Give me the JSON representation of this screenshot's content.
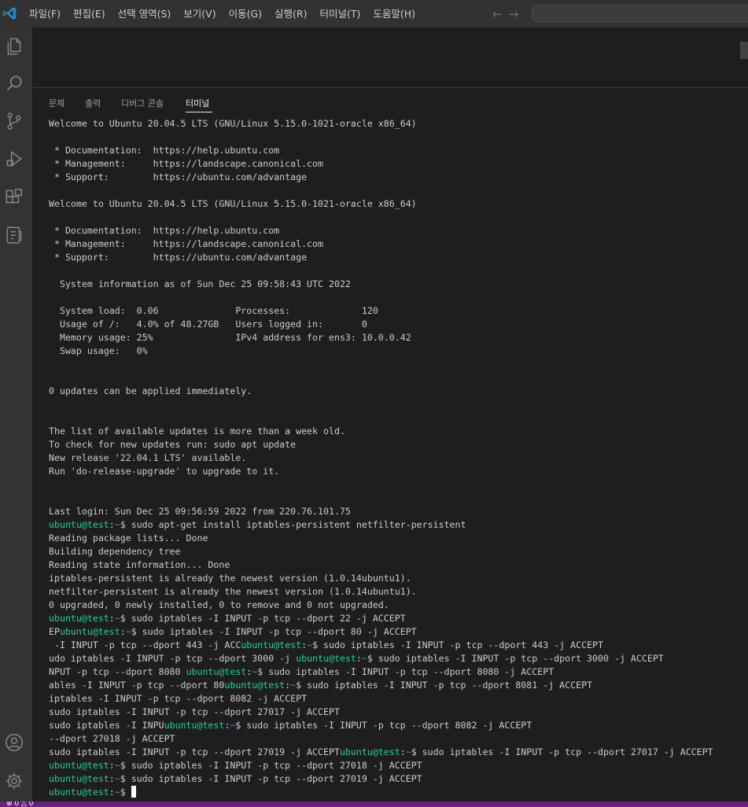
{
  "titlebar": {
    "logo_icon": "vscode-logo-icon",
    "menu": [
      "파일(F)",
      "편집(E)",
      "선택 영역(S)",
      "보기(V)",
      "이동(G)",
      "실행(R)",
      "터미널(T)",
      "도움말(H)"
    ],
    "back_icon": "←",
    "forward_icon": "→"
  },
  "activity_bar": {
    "items": [
      "explorer-icon",
      "search-icon",
      "source-control-icon",
      "run-debug-icon",
      "extensions-icon",
      "remote-explorer-icon"
    ],
    "bottom": [
      "account-icon",
      "manage-gear-icon"
    ]
  },
  "panel": {
    "tabs": [
      "문제",
      "출력",
      "디버그 콘솔",
      "터미널"
    ],
    "active_tab": "터미널"
  },
  "terminal": {
    "prompt_user": "ubuntu@test",
    "prompt_path": "~",
    "lines": [
      [
        {
          "t": "Welcome to Ubuntu 20.04.5 LTS (GNU/Linux 5.15.0-1021-oracle x86_64)"
        }
      ],
      [],
      [
        {
          "t": " * Documentation:  https://help.ubuntu.com"
        }
      ],
      [
        {
          "t": " * Management:     https://landscape.canonical.com"
        }
      ],
      [
        {
          "t": " * Support:        https://ubuntu.com/advantage"
        }
      ],
      [],
      [
        {
          "t": "Welcome to Ubuntu 20.04.5 LTS (GNU/Linux 5.15.0-1021-oracle x86_64)"
        }
      ],
      [],
      [
        {
          "t": " * Documentation:  https://help.ubuntu.com"
        }
      ],
      [
        {
          "t": " * Management:     https://landscape.canonical.com"
        }
      ],
      [
        {
          "t": " * Support:        https://ubuntu.com/advantage"
        }
      ],
      [],
      [
        {
          "t": "  System information as of Sun Dec 25 09:58:43 UTC 2022"
        }
      ],
      [],
      [
        {
          "t": "  System load:  0.06              Processes:             120"
        }
      ],
      [
        {
          "t": "  Usage of /:   4.0% of 48.27GB   Users logged in:       0"
        }
      ],
      [
        {
          "t": "  Memory usage: 25%               IPv4 address for ens3: 10.0.0.42"
        }
      ],
      [
        {
          "t": "  Swap usage:   0%"
        }
      ],
      [],
      [],
      [
        {
          "t": "0 updates can be applied immediately."
        }
      ],
      [],
      [],
      [
        {
          "t": "The list of available updates is more than a week old."
        }
      ],
      [
        {
          "t": "To check for new updates run: sudo apt update"
        }
      ],
      [
        {
          "t": "New release '22.04.1 LTS' available."
        }
      ],
      [
        {
          "t": "Run 'do-release-upgrade' to upgrade to it."
        }
      ],
      [],
      [],
      [
        {
          "t": "Last login: Sun Dec 25 09:56:59 2022 from 220.76.101.75"
        }
      ],
      [
        {
          "p": 1
        },
        {
          "t": "$ sudo apt-get install iptables-persistent netfilter-persistent"
        }
      ],
      [
        {
          "t": "Reading package lists... Done"
        }
      ],
      [
        {
          "t": "Building dependency tree"
        }
      ],
      [
        {
          "t": "Reading state information... Done"
        }
      ],
      [
        {
          "t": "iptables-persistent is already the newest version (1.0.14ubuntu1)."
        }
      ],
      [
        {
          "t": "netfilter-persistent is already the newest version (1.0.14ubuntu1)."
        }
      ],
      [
        {
          "t": "0 upgraded, 0 newly installed, 0 to remove and 0 not upgraded."
        }
      ],
      [
        {
          "p": 1
        },
        {
          "t": "$ sudo iptables -I INPUT -p tcp --dport 22 -j ACCEPT"
        }
      ],
      [
        {
          "t": "EP"
        },
        {
          "p": 1
        },
        {
          "t": "$ sudo iptables -I INPUT -p tcp --dport 80 -j ACCEPT"
        }
      ],
      [
        {
          "t": " -I INPUT -p tcp --dport 443 -j ACC"
        },
        {
          "p": 1
        },
        {
          "t": "$ sudo iptables -I INPUT -p tcp --dport 443 -j ACCEPT"
        }
      ],
      [
        {
          "t": "udo iptables -I INPUT -p tcp --dport 3000 -j "
        },
        {
          "p": 1
        },
        {
          "t": "$ sudo iptables -I INPUT -p tcp --dport 3000 -j ACCEPT"
        }
      ],
      [
        {
          "t": "NPUT -p tcp --dport 8080 "
        },
        {
          "p": 1
        },
        {
          "t": "$ sudo iptables -I INPUT -p tcp --dport 8080 -j ACCEPT"
        }
      ],
      [
        {
          "t": "ables -I INPUT -p tcp --dport 80"
        },
        {
          "p": 1
        },
        {
          "t": "$ sudo iptables -I INPUT -p tcp --dport 8081 -j ACCEPT"
        }
      ],
      [
        {
          "t": "iptables -I INPUT -p tcp --dport 8082 -j ACCEPT"
        }
      ],
      [
        {
          "t": "sudo iptables -I INPUT -p tcp --dport 27017 -j ACCEPT"
        }
      ],
      [
        {
          "t": "sudo iptables -I INPU"
        },
        {
          "p": 1
        },
        {
          "t": "$ sudo iptables -I INPUT -p tcp --dport 8082 -j ACCEPT"
        }
      ],
      [
        {
          "t": "--dport 27018 -j ACCEPT"
        }
      ],
      [
        {
          "t": "sudo iptables -I INPUT -p tcp --dport 27019 -j ACCEPT"
        },
        {
          "p": 1
        },
        {
          "t": "$ sudo iptables -I INPUT -p tcp --dport 27017 -j ACCEPT"
        }
      ],
      [
        {
          "p": 1
        },
        {
          "t": "$ sudo iptables -I INPUT -p tcp --dport 27018 -j ACCEPT"
        }
      ],
      [
        {
          "p": 1
        },
        {
          "t": "$ sudo iptables -I INPUT -p tcp --dport 27019 -j ACCEPT"
        }
      ],
      [
        {
          "p": 1
        },
        {
          "t": "$ "
        },
        {
          "c": 1
        }
      ]
    ]
  },
  "statusbar": {
    "text": "⊗ 0 △ 0"
  },
  "colors": {
    "accent": "#68217a",
    "prompt": "#23d18b",
    "path": "#3b8eea",
    "background": "#1e1e1e"
  }
}
